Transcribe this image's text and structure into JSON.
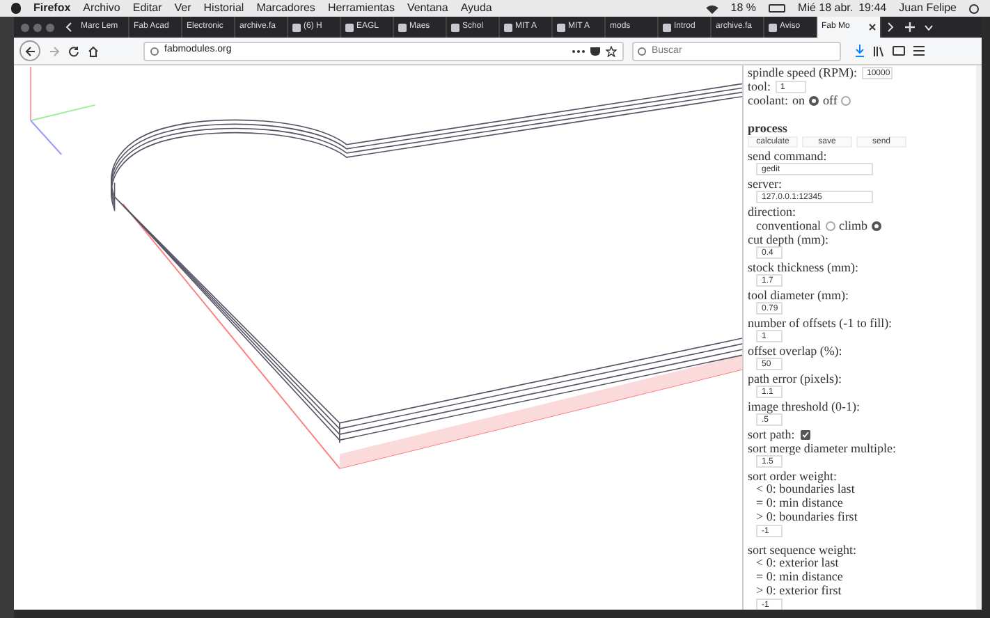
{
  "menu_bar": {
    "app": "Firefox",
    "items": [
      "Archivo",
      "Editar",
      "Ver",
      "Historial",
      "Marcadores",
      "Herramientas",
      "Ventana",
      "Ayuda"
    ],
    "battery": "18 %",
    "date": "Mié 18 abr.",
    "time": "19:44",
    "user": "Juan Felipe"
  },
  "tabs": [
    {
      "label": "Marc Lem",
      "favicon": false,
      "selected": false
    },
    {
      "label": "Fab Acad",
      "favicon": false,
      "selected": false
    },
    {
      "label": "Electronic",
      "favicon": false,
      "selected": false
    },
    {
      "label": "archive.fa",
      "favicon": false,
      "selected": false
    },
    {
      "label": "(6) H",
      "favicon": true,
      "selected": false
    },
    {
      "label": "EAGL",
      "favicon": true,
      "selected": false
    },
    {
      "label": "Maes",
      "favicon": true,
      "selected": false
    },
    {
      "label": "Schol",
      "favicon": true,
      "selected": false
    },
    {
      "label": "MIT A",
      "favicon": true,
      "selected": false
    },
    {
      "label": "MIT A",
      "favicon": true,
      "selected": false
    },
    {
      "label": "mods",
      "favicon": false,
      "selected": false
    },
    {
      "label": "Introd",
      "favicon": true,
      "selected": false
    },
    {
      "label": "archive.fa",
      "favicon": false,
      "selected": false
    },
    {
      "label": "Aviso",
      "favicon": true,
      "selected": false
    },
    {
      "label": "Fab Mo",
      "favicon": false,
      "selected": true
    }
  ],
  "address": "fabmodules.org",
  "search": {
    "placeholder": "Buscar"
  },
  "panel": [
    {
      "kind": "inline",
      "label": "spindle speed (RPM):",
      "value": "10000"
    },
    {
      "kind": "inline",
      "label": "tool:",
      "value": "1"
    },
    {
      "kind": "radios",
      "label": "coolant:",
      "indent": false,
      "options": [
        {
          "label": "on",
          "selected": true
        },
        {
          "label": "off",
          "selected": false
        }
      ]
    },
    {
      "kind": "heading",
      "label": "process"
    },
    {
      "kind": "buttons",
      "buttons": [
        "calculate",
        "save",
        "send"
      ]
    },
    {
      "kind": "field",
      "label": "send command:",
      "value": "gedit",
      "wide": true
    },
    {
      "kind": "field",
      "label": "server:",
      "value": "127.0.0.1:12345",
      "wide": true
    },
    {
      "kind": "radios",
      "label": "direction:",
      "indent": true,
      "options": [
        {
          "label": "conventional",
          "selected": false
        },
        {
          "label": "climb",
          "selected": true
        }
      ]
    },
    {
      "kind": "field",
      "label": "cut depth (mm):",
      "value": "0.4",
      "wide": false
    },
    {
      "kind": "field",
      "label": "stock thickness (mm):",
      "value": "1.7",
      "wide": false
    },
    {
      "kind": "field",
      "label": "tool diameter (mm):",
      "value": "0.79",
      "wide": false
    },
    {
      "kind": "field",
      "label": "number of offsets (-1 to fill):",
      "value": "1",
      "wide": false
    },
    {
      "kind": "field",
      "label": "offset overlap (%):",
      "value": "50",
      "wide": false
    },
    {
      "kind": "field",
      "label": "path error (pixels):",
      "value": "1.1",
      "wide": false
    },
    {
      "kind": "field",
      "label": "image threshold (0-1):",
      "value": ".5",
      "wide": false
    },
    {
      "kind": "checkbox",
      "label": "sort path:",
      "checked": true
    },
    {
      "kind": "field",
      "label": "sort merge diameter multiple:",
      "value": "1.5",
      "wide": false
    },
    {
      "kind": "weight",
      "label": "sort order weight:",
      "notes": [
        "< 0: boundaries last",
        "= 0: min distance",
        "> 0: boundaries first"
      ],
      "entry": "-1"
    },
    {
      "kind": "weight",
      "label": "sort sequence weight:",
      "notes": [
        "< 0: exterior last",
        "= 0: min distance",
        "> 0: exterior first"
      ],
      "entry": "-1"
    }
  ]
}
